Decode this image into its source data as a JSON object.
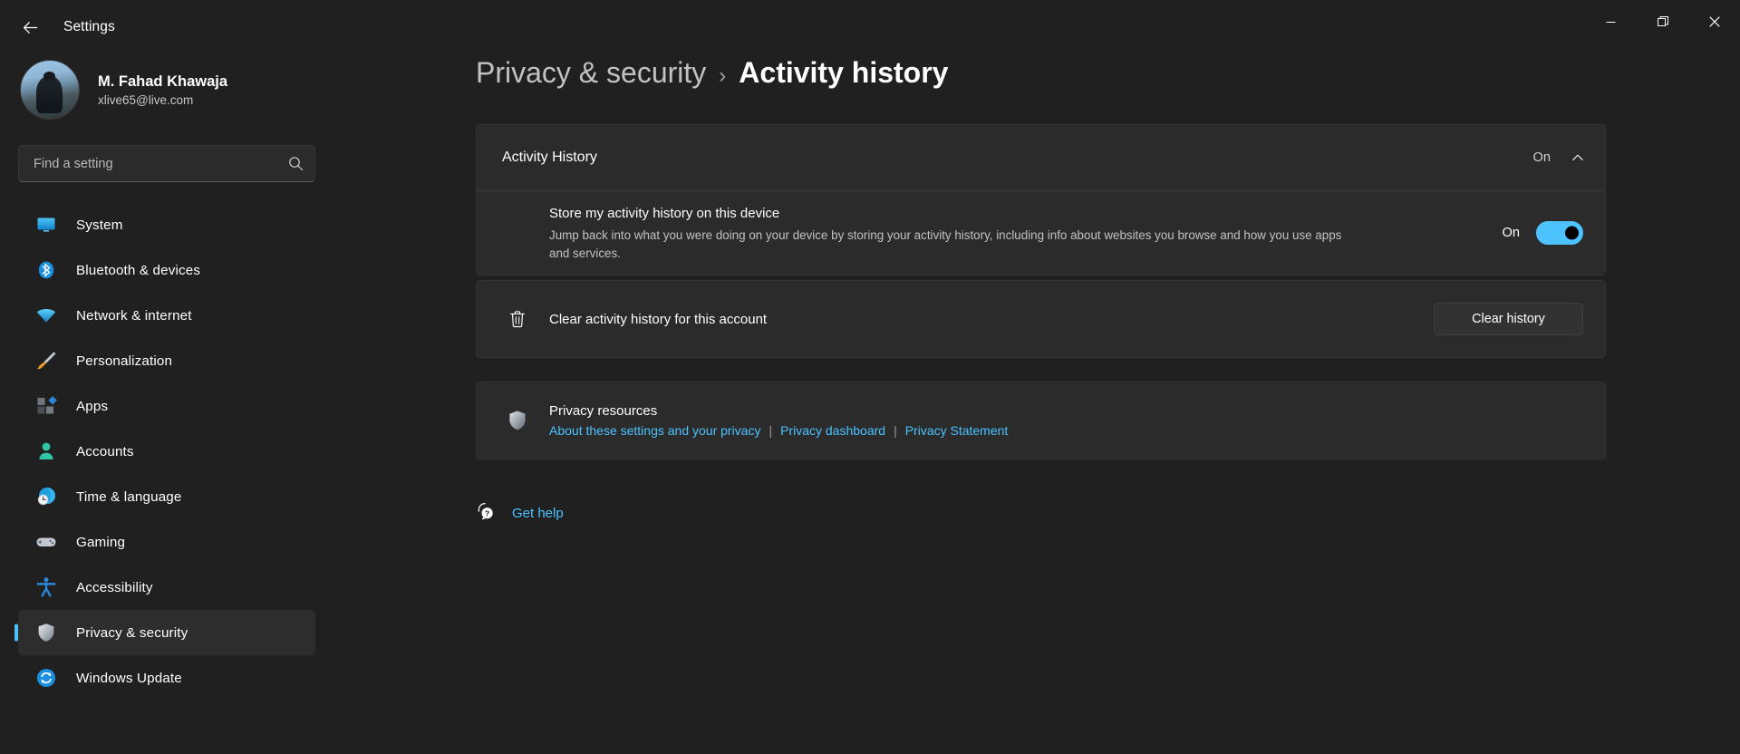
{
  "window": {
    "app_title": "Settings",
    "back_icon": "back-arrow-icon",
    "minimize_label": "—",
    "maximize_label": "❐",
    "close_label": "✕"
  },
  "account": {
    "name": "M. Fahad Khawaja",
    "email": "xlive65@live.com"
  },
  "search": {
    "placeholder": "Find a setting",
    "value": "",
    "icon": "search-icon"
  },
  "sidebar": {
    "items": [
      {
        "label": "System",
        "icon": "system-monitor-icon",
        "active": false
      },
      {
        "label": "Bluetooth & devices",
        "icon": "bluetooth-icon",
        "active": false
      },
      {
        "label": "Network & internet",
        "icon": "wifi-icon",
        "active": false
      },
      {
        "label": "Personalization",
        "icon": "paintbrush-icon",
        "active": false
      },
      {
        "label": "Apps",
        "icon": "apps-grid-icon",
        "active": false
      },
      {
        "label": "Accounts",
        "icon": "person-icon",
        "active": false
      },
      {
        "label": "Time & language",
        "icon": "clock-globe-icon",
        "active": false
      },
      {
        "label": "Gaming",
        "icon": "gamepad-icon",
        "active": false
      },
      {
        "label": "Accessibility",
        "icon": "accessibility-person-icon",
        "active": false
      },
      {
        "label": "Privacy & security",
        "icon": "shield-icon",
        "active": true
      },
      {
        "label": "Windows Update",
        "icon": "refresh-circle-icon",
        "active": false
      }
    ]
  },
  "breadcrumb": {
    "parent": "Privacy & security",
    "separator": "›",
    "current": "Activity history"
  },
  "activity_history": {
    "expander_title": "Activity History",
    "expander_state": "On",
    "chevron_icon": "chevron-up-icon",
    "store_setting": {
      "title": "Store my activity history on this device",
      "description": "Jump back into what you were doing on your device by storing your activity history, including info about websites you browse and how you use apps and services.",
      "toggle_label": "On",
      "toggle_on": true
    },
    "clear_setting": {
      "icon": "trash-icon",
      "title": "Clear activity history for this account",
      "button_label": "Clear history"
    }
  },
  "privacy_resources": {
    "icon": "shield-icon",
    "title": "Privacy resources",
    "links": [
      "About these settings and your privacy",
      "Privacy dashboard",
      "Privacy Statement"
    ],
    "separator": "|"
  },
  "get_help": {
    "icon": "help-question-icon",
    "label": "Get help"
  },
  "colors": {
    "accent": "#4cc2ff",
    "background": "#202020",
    "card": "#2b2b2b"
  }
}
